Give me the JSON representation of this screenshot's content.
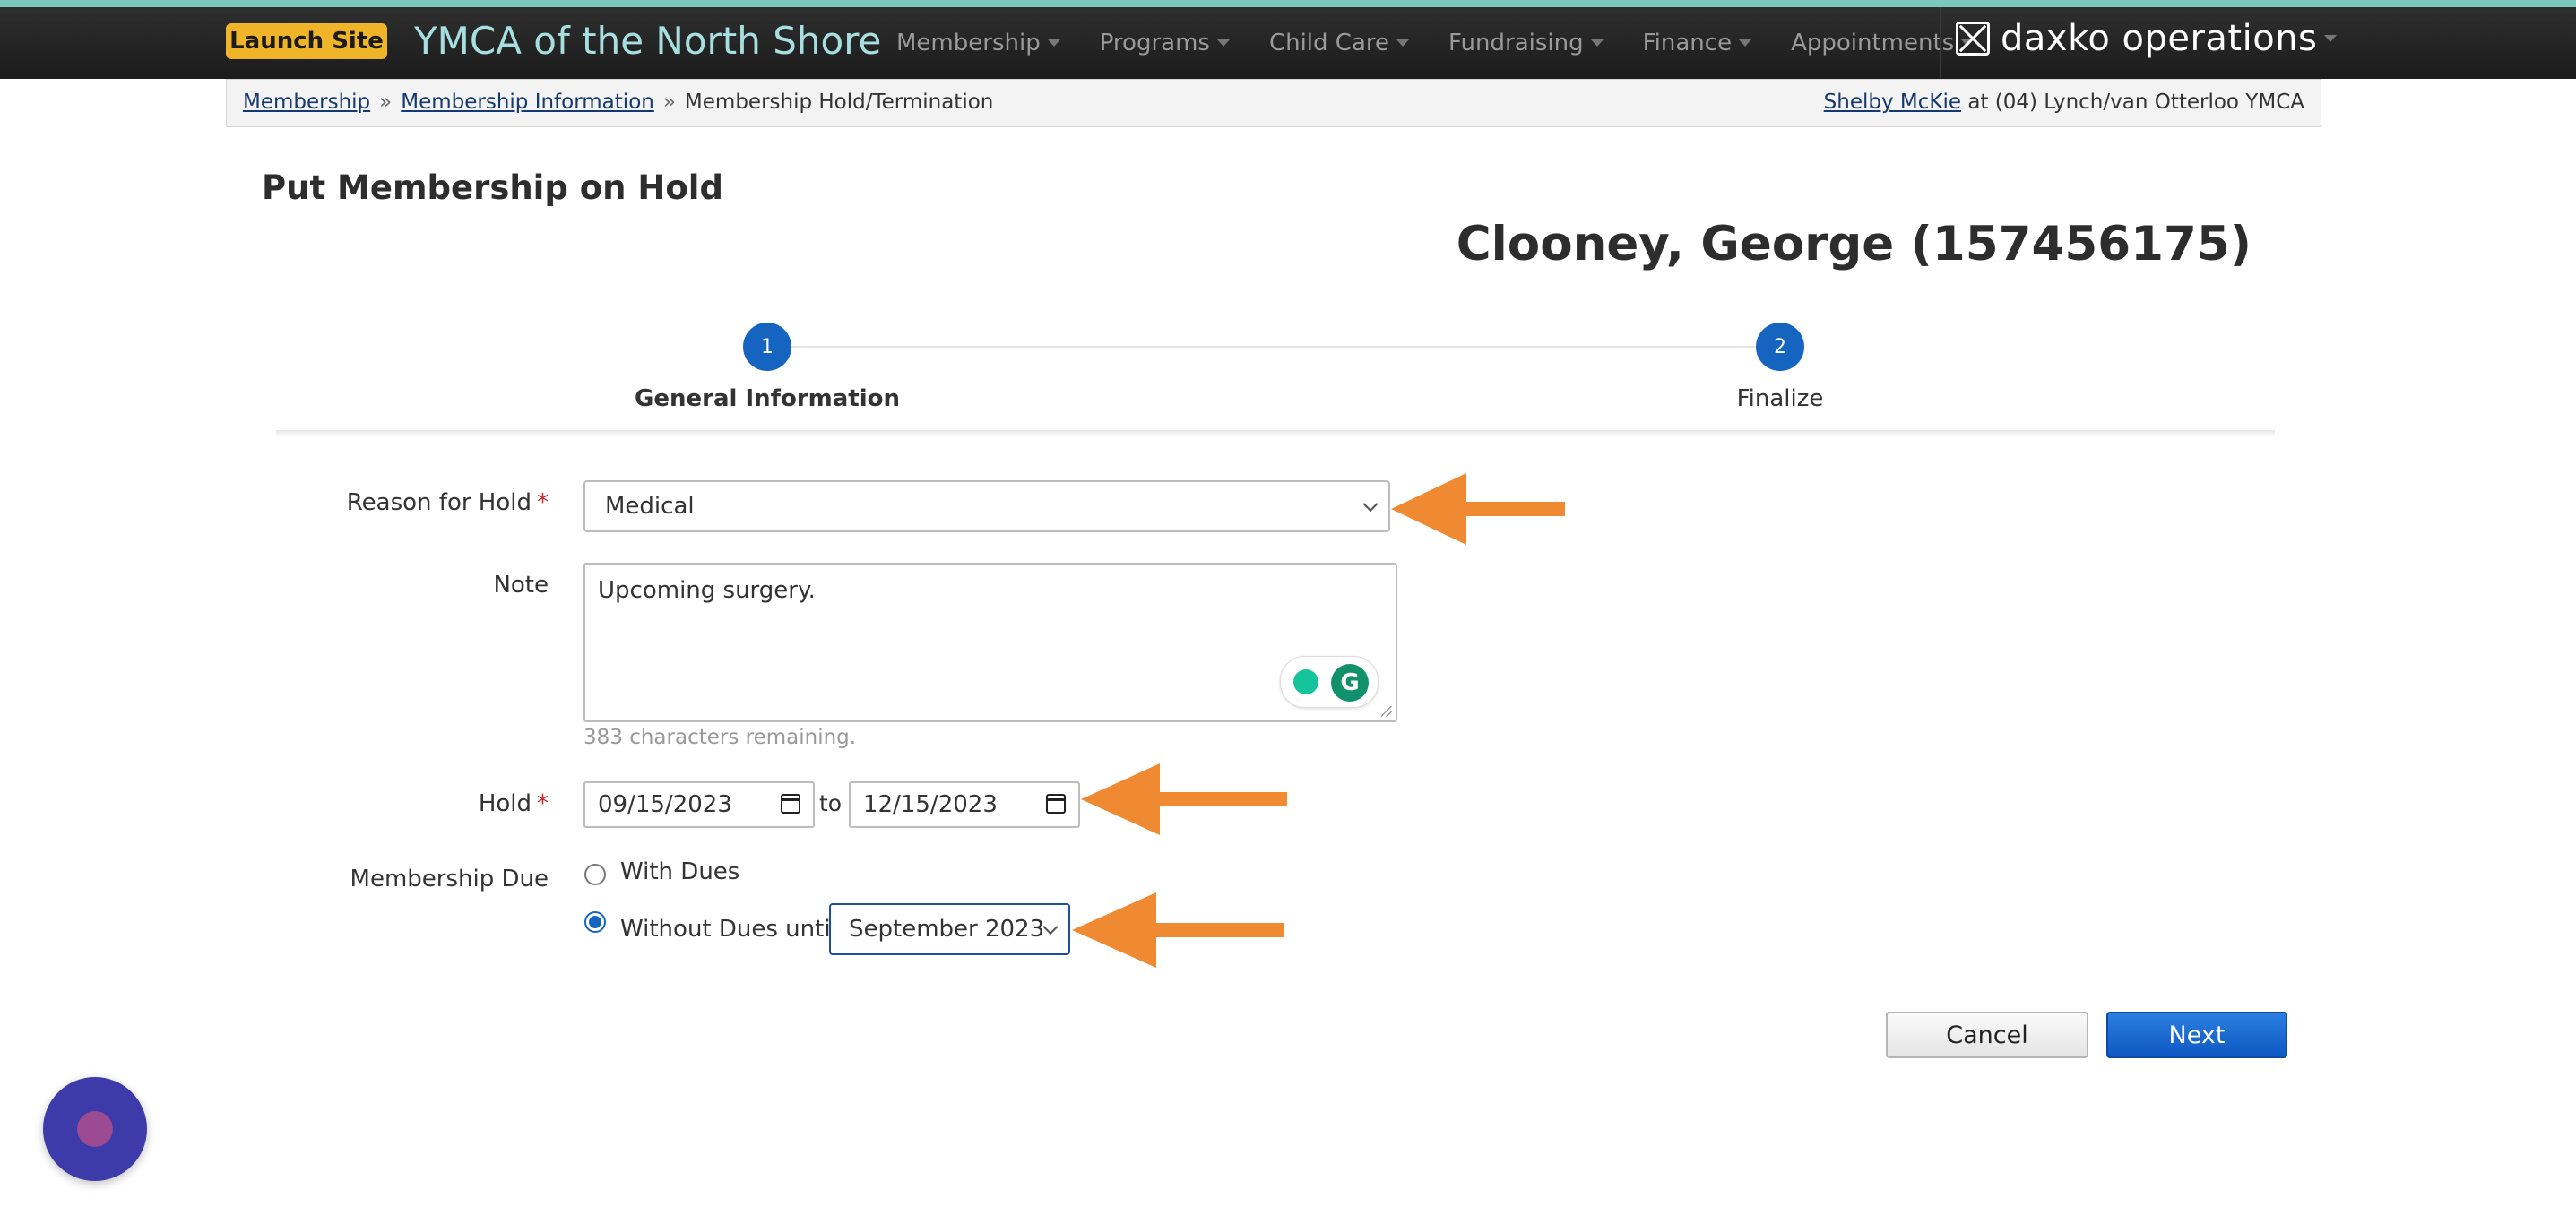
{
  "nav": {
    "launch_label": "Launch Site",
    "brand": "YMCA of the North Shore",
    "menu": [
      "Membership",
      "Programs",
      "Child Care",
      "Fundraising",
      "Finance",
      "Appointments"
    ],
    "product": "daxko operations"
  },
  "breadcrumb": {
    "items": [
      "Membership",
      "Membership Information"
    ],
    "current": "Membership Hold/Termination",
    "separator": "»"
  },
  "user": {
    "name": "Shelby McKie",
    "location": "at (04) Lynch/van Otterloo YMCA"
  },
  "page": {
    "title": "Put Membership on Hold",
    "member": "Clooney, George (157456175)"
  },
  "steps": [
    {
      "number": "1",
      "label": "General Information"
    },
    {
      "number": "2",
      "label": "Finalize"
    }
  ],
  "form": {
    "reason_label": "Reason for Hold",
    "reason_value": "Medical",
    "note_label": "Note",
    "note_value": "Upcoming surgery.",
    "chars_remaining": "383 characters remaining.",
    "hold_label": "Hold",
    "hold_from": "09/15/2023",
    "hold_to_text": "to",
    "hold_to": "12/15/2023",
    "due_label": "Membership Due",
    "with_dues": "With Dues",
    "without_dues": "Without Dues until",
    "until_value": "September 2023",
    "required_mark": "*"
  },
  "buttons": {
    "cancel": "Cancel",
    "next": "Next"
  },
  "colors": {
    "accent": "#1565c0",
    "annotation_arrow": "#ef8a32",
    "launch": "#f0b429",
    "brand_text": "#a7dfe0"
  }
}
